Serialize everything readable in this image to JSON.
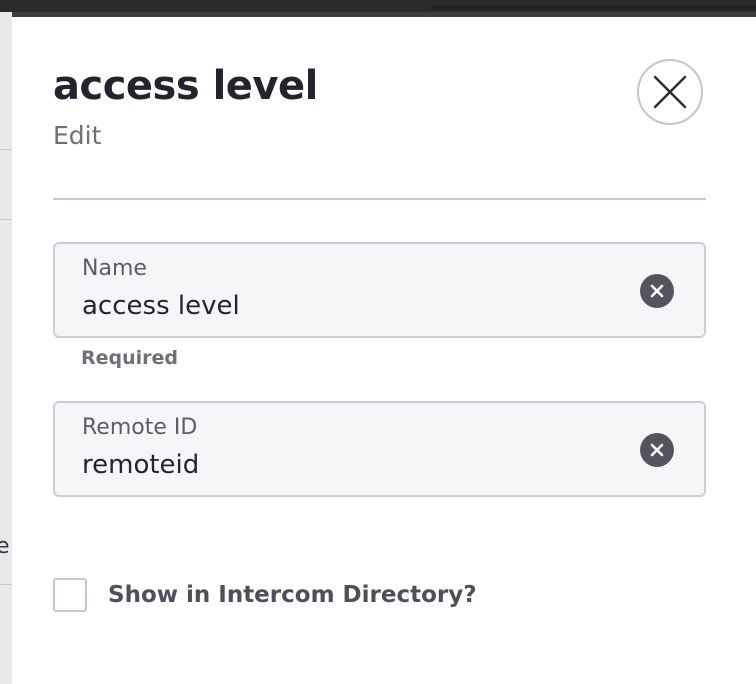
{
  "background": {
    "partial_text": "e"
  },
  "modal": {
    "title": "access level",
    "subtitle": "Edit",
    "close_icon": "close-x-icon"
  },
  "fields": {
    "name": {
      "label": "Name",
      "value": "access level",
      "helper": "Required",
      "clear_icon": "clear-circle-icon"
    },
    "remote_id": {
      "label": "Remote ID",
      "value": "remoteid",
      "clear_icon": "clear-circle-icon"
    }
  },
  "intercom_directory": {
    "label": "Show in Intercom Directory?",
    "checked": false
  },
  "colors": {
    "title_text": "#24242e",
    "muted_text": "#6f6f78",
    "field_border": "#cfccd9",
    "field_background": "#f6f6f9",
    "clear_icon_fill": "#55545e",
    "close_ring": "#c7c3d1"
  }
}
